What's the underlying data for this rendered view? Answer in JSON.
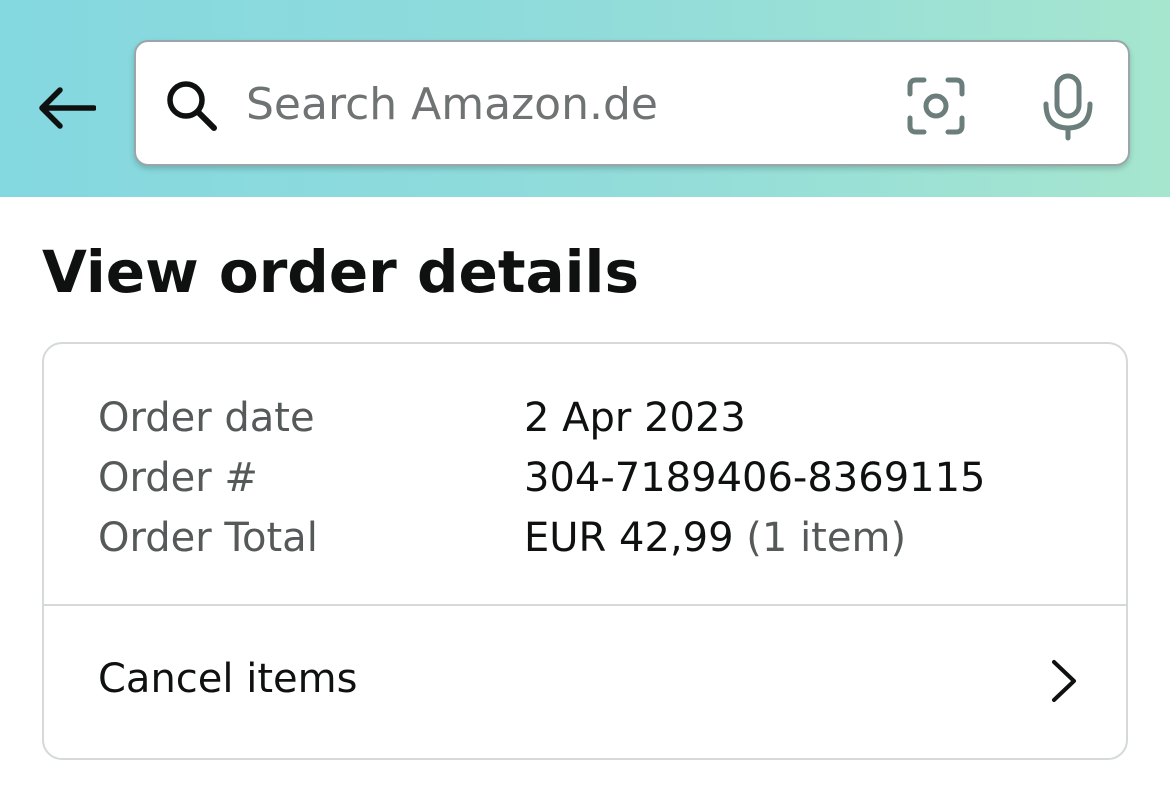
{
  "header": {
    "search": {
      "placeholder": "Search Amazon.de",
      "value": ""
    },
    "icons": {
      "back": "arrow-left-icon",
      "search": "search-icon",
      "camera": "camera-scan-icon",
      "mic": "microphone-icon"
    }
  },
  "page": {
    "title": "View order details"
  },
  "order": {
    "date_label": "Order date",
    "date_value": "2 Apr 2023",
    "number_label": "Order #",
    "number_value": "304-7189406-8369115",
    "total_label": "Order Total",
    "total_value": "EUR 42,99",
    "total_items": "(1 item)"
  },
  "actions": {
    "cancel_label": "Cancel items"
  },
  "colors": {
    "header_gradient_start": "#84d8e0",
    "header_gradient_end": "#a6e6cf",
    "text_primary": "#0f1111",
    "text_secondary": "#565959",
    "border": "#d5d9d9"
  }
}
